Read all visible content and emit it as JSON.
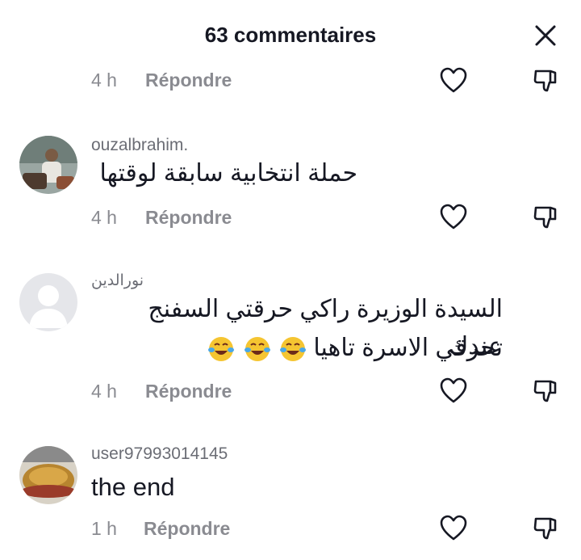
{
  "header": {
    "title": "63 commentaires",
    "close_icon": "close-icon"
  },
  "comments": [
    {
      "username": "",
      "text": "",
      "time": "4 h",
      "reply": "Répondre"
    },
    {
      "username": "ouzalbrahim.",
      "text": "حملة انتخابية سابقة لوقتها",
      "time": "4 h",
      "reply": "Répondre"
    },
    {
      "username": "نورالدين",
      "text_line1": "السيدة الوزيرة راكي حرقتي السفنج عندك",
      "text_line2": "تحرقي الاسرة تاهيا",
      "emoji": "😂😂😂",
      "time": "4 h",
      "reply": "Répondre"
    },
    {
      "username": "user97993014145",
      "text": "the end",
      "time": "1 h",
      "reply": "Répondre"
    }
  ],
  "icons": {
    "like": "heart-outline-icon",
    "dislike": "thumbs-down-icon"
  },
  "colors": {
    "text": "#161823",
    "secondary": "#8a8b91",
    "username": "#6b6d75",
    "background": "#ffffff"
  }
}
